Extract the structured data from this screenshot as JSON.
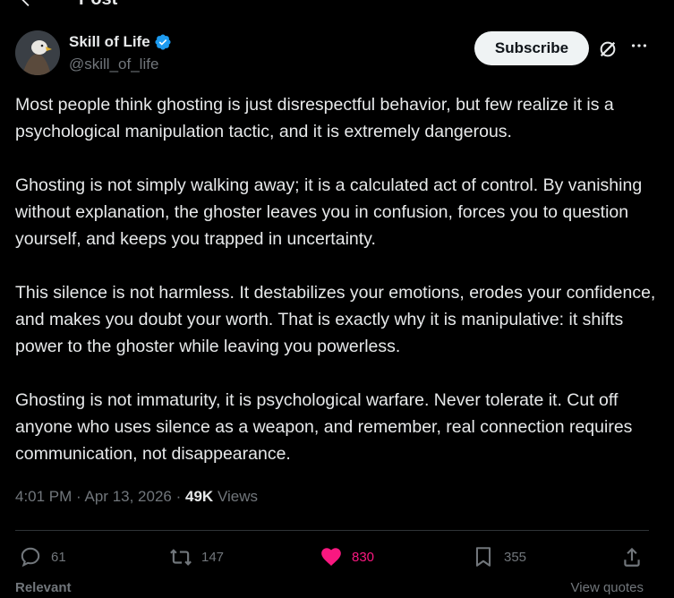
{
  "top_bar": {
    "back_icon": "arrow-left-icon",
    "title": "Post"
  },
  "author": {
    "name": "Skill of Life",
    "handle": "@skill_of_life",
    "verified": true,
    "verified_color": "#1d9bf0",
    "avatar_icon": "eagle-avatar"
  },
  "header_actions": {
    "subscribe_label": "Subscribe",
    "grok_icon": "grok-icon",
    "more_icon": "more-dots-icon"
  },
  "post": {
    "paragraphs": [
      "Most people think ghosting is just disrespectful behavior, but few realize it is a psychological manipulation tactic, and it is extremely dangerous.",
      "Ghosting is not simply walking away; it is a calculated act of control. By vanishing without explanation, the ghoster leaves you in confusion, forces you to question yourself, and keeps you trapped in uncertainty.",
      "This silence is not harmless. It destabilizes your emotions, erodes your confidence, and makes you doubt your worth. That is exactly why it is manipulative: it shifts power to the ghoster while leaving you powerless.",
      "Ghosting is not immaturity, it is psychological warfare. Never tolerate it. Cut off anyone who uses silence as a weapon, and remember, real connection requires communication, not disappearance."
    ],
    "time": "4:01 PM",
    "separator": "·",
    "date": "Apr 13, 2026",
    "views_count": "49K",
    "views_label": "Views"
  },
  "actions": {
    "replies": {
      "icon": "reply-icon",
      "count": "61"
    },
    "reposts": {
      "icon": "repost-icon",
      "count": "147"
    },
    "likes": {
      "icon": "heart-filled-icon",
      "count": "830",
      "color": "#f91880"
    },
    "bookmarks": {
      "icon": "bookmark-icon",
      "count": "355"
    },
    "share": {
      "icon": "share-icon"
    }
  },
  "bottom": {
    "sort_label": "Relevant",
    "quotes_label": "View quotes"
  },
  "colors": {
    "background": "#000000",
    "text": "#e7e9ea",
    "muted": "#71767b",
    "divider": "#2f3336"
  }
}
